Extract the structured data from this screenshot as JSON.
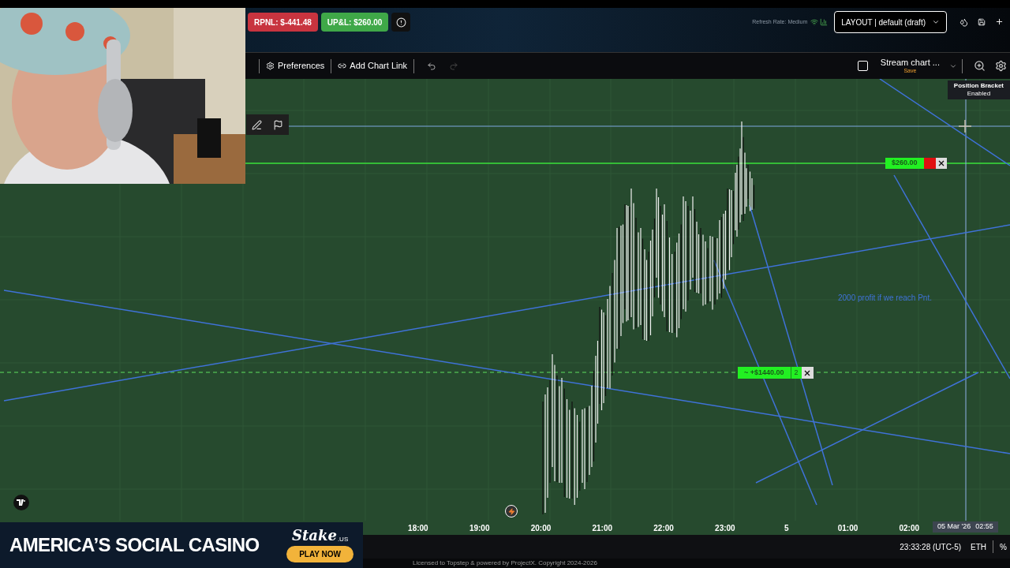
{
  "account_bar": {
    "pills": [
      {
        "label": "RPNL: $-441.48",
        "kind": "loss"
      },
      {
        "label": "UP&L: $260.00",
        "kind": "gain"
      }
    ],
    "refresh_rate": "Refresh Rate: Medium",
    "layout": "LAYOUT | default (draft)"
  },
  "toolbar": {
    "items": [
      {
        "label": "Preferences",
        "kind": "gear"
      },
      {
        "label": "Add Chart Link",
        "kind": "link"
      }
    ],
    "redo_disabled": true,
    "stream_chart": {
      "checked": false,
      "name": "Stream chart ...",
      "action": "Save"
    }
  },
  "chart": {
    "tooltip": {
      "title": "Position Bracket",
      "status": "Enabled"
    },
    "target_order": {
      "label": "$260.00"
    },
    "position": {
      "label": "~ +$1440.00",
      "qty": "2"
    },
    "note": "2000 profit if we reach Pnt.",
    "time_axis": [
      "18:00",
      "19:00",
      "20:00",
      "21:00",
      "22:00",
      "23:00",
      "5",
      "01:00",
      "02:00"
    ],
    "crosshair": {
      "date": "05 Mar '26",
      "time": "02:55"
    }
  },
  "status_bar": {
    "clock": "23:33:28 (UTC-5)",
    "session": "ETH",
    "percent": "%"
  },
  "footer": "Licensed to Topstep & powered by ProjectX. Copyright 2024-2026",
  "ad": {
    "headline": "AMERICA’S SOCIAL CASINO",
    "brand": "Stake",
    "brand_sub": ".US",
    "cta": "PLAY NOW"
  }
}
